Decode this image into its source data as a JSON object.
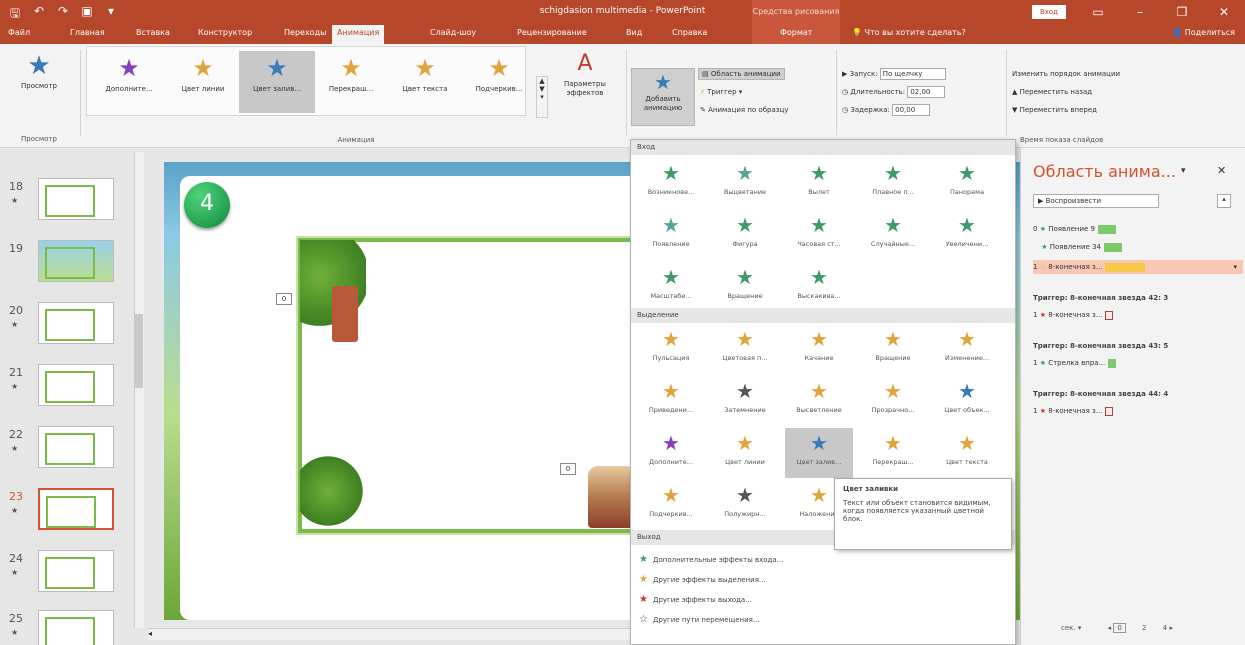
{
  "titlebar": {
    "title": "schigdasion multimedia - PowerPoint",
    "context_group": "Средства рисования",
    "signin": "Вход"
  },
  "tabs": [
    "Файл",
    "Главная",
    "Вставка",
    "Конструктор",
    "Переходы",
    "Анимация",
    "Слайд-шоу",
    "Рецензирование",
    "Вид",
    "Справка",
    "Формат"
  ],
  "tell_me": "Что вы хотите сделать?",
  "share": "Поделиться",
  "ribbon": {
    "preview": {
      "label": "Просмотр",
      "group": "Просмотр"
    },
    "gallery": [
      {
        "label": "Дополните...",
        "icon": "star-icon",
        "color": "#8a3fc0"
      },
      {
        "label": "Цвет линии",
        "icon": "star-icon",
        "color": "#e0a43b"
      },
      {
        "label": "Цвет залив...",
        "icon": "star-icon",
        "color": "#3a7ab6"
      },
      {
        "label": "Перекраш...",
        "icon": "star-icon",
        "color": "#e0a43b"
      },
      {
        "label": "Цвет текста",
        "icon": "star-icon",
        "color": "#e0a43b"
      },
      {
        "label": "Подчеркив...",
        "icon": "star-icon",
        "color": "#e0a43b"
      }
    ],
    "effect_params": "Параметры эффектов",
    "anim_group": "Анимация",
    "add_anim": "Добавить анимацию",
    "anim_pane_btn": "Область анимации",
    "trigger": "Триггер",
    "anim_painter": "Анимация по образцу",
    "start_label": "Запуск:",
    "start_value": "По щелчку",
    "duration_label": "Длительность:",
    "duration_value": "02,00",
    "delay_label": "Задержка:",
    "delay_value": "00,00",
    "reorder_title": "Изменить порядок анимации",
    "move_earlier": "Переместить назад",
    "move_later": "Переместить вперед",
    "timing_group": "Время показа слайдов"
  },
  "slides": [
    {
      "num": "18"
    },
    {
      "num": "19"
    },
    {
      "num": "20"
    },
    {
      "num": "21"
    },
    {
      "num": "22"
    },
    {
      "num": "23"
    },
    {
      "num": "24"
    },
    {
      "num": "25"
    }
  ],
  "slide": {
    "badge": "4",
    "tag1": "0",
    "tag2": "0"
  },
  "dropdown": {
    "entrance_title": "Вход",
    "entrance": [
      {
        "label": "Возникнове...",
        "color": "#3c9a6b"
      },
      {
        "label": "Выцветание",
        "color": "#56a39a"
      },
      {
        "label": "Вылет",
        "color": "#3c9a6b"
      },
      {
        "label": "Плавное п...",
        "color": "#3c9a6b"
      },
      {
        "label": "Панорама",
        "color": "#3c9a6b"
      },
      {
        "label": "Появление",
        "color": "#56a39a"
      },
      {
        "label": "Фигура",
        "color": "#3c9a6b"
      },
      {
        "label": "Часовая ст...",
        "color": "#3c9a6b"
      },
      {
        "label": "Случайные...",
        "color": "#3c9a6b"
      },
      {
        "label": "Увеличени...",
        "color": "#3c9a6b"
      },
      {
        "label": "Масштабе...",
        "color": "#3c9a6b"
      },
      {
        "label": "Вращение",
        "color": "#3c9a6b"
      },
      {
        "label": "Выскакива...",
        "color": "#3c9a6b"
      }
    ],
    "emphasis_title": "Выделение",
    "emphasis": [
      {
        "label": "Пульсация",
        "color": "#e0a43b"
      },
      {
        "label": "Цветовая п...",
        "color": "#e0a43b"
      },
      {
        "label": "Качание",
        "color": "#e0a43b"
      },
      {
        "label": "Вращение",
        "color": "#e0a43b"
      },
      {
        "label": "Изменение...",
        "color": "#e0a43b"
      },
      {
        "label": "Приведени...",
        "color": "#e0a43b"
      },
      {
        "label": "Затемнение",
        "color": "#555555"
      },
      {
        "label": "Высветление",
        "color": "#e0a43b"
      },
      {
        "label": "Прозрачно...",
        "color": "#e0a43b"
      },
      {
        "label": "Цвет объек...",
        "color": "#3a7ab6"
      },
      {
        "label": "Дополните...",
        "color": "#8a3fc0"
      },
      {
        "label": "Цвет линии",
        "color": "#e0a43b"
      },
      {
        "label": "Цвет залив...",
        "color": "#3a7ab6"
      },
      {
        "label": "Перекраш...",
        "color": "#e0a43b"
      },
      {
        "label": "Цвет текста",
        "color": "#e0a43b"
      },
      {
        "label": "Подчеркив...",
        "color": "#e0a43b"
      },
      {
        "label": "Полужирн...",
        "color": "#555555"
      },
      {
        "label": "Наложение",
        "color": "#e0a43b"
      }
    ],
    "exit_title": "Выход",
    "more": [
      {
        "label": "Дополнительные эффекты входа...",
        "color": "#3c9a6b"
      },
      {
        "label": "Другие эффекты выделения...",
        "color": "#e0a43b"
      },
      {
        "label": "Другие эффекты выхода...",
        "color": "#c0392b"
      },
      {
        "label": "Другие пути перемещения...",
        "color": "#555555"
      }
    ]
  },
  "tooltip": {
    "title": "Цвет заливки",
    "text": "Текст или объект становится видимым, когда появляется указанный цветной блок."
  },
  "anim_pane": {
    "title": "Область анима...",
    "play": "Воспроизвести",
    "items": [
      {
        "num": "0",
        "label": "Появление 9",
        "color": "#7ec96a"
      },
      {
        "num": "",
        "label": "Появление 34",
        "color": "#7ec96a"
      },
      {
        "num": "1",
        "label": "8-конечная з...",
        "color": "#f7c94b"
      }
    ],
    "triggers": [
      {
        "title": "Триггер: 8-конечная звезда 42: 3",
        "num": "1",
        "label": "8-конечная з...",
        "color": "#c0392b"
      },
      {
        "title": "Триггер: 8-конечная звезда 43: 5",
        "num": "1",
        "label": "Стрелка впра...",
        "color": "#7ec96a"
      },
      {
        "title": "Триггер: 8-конечная звезда 44: 4",
        "num": "1",
        "label": "8-конечная з...",
        "color": "#c0392b"
      }
    ],
    "footer_unit": "сек.",
    "footer_start": "0",
    "footer_mid": "2",
    "footer_end": "4"
  }
}
